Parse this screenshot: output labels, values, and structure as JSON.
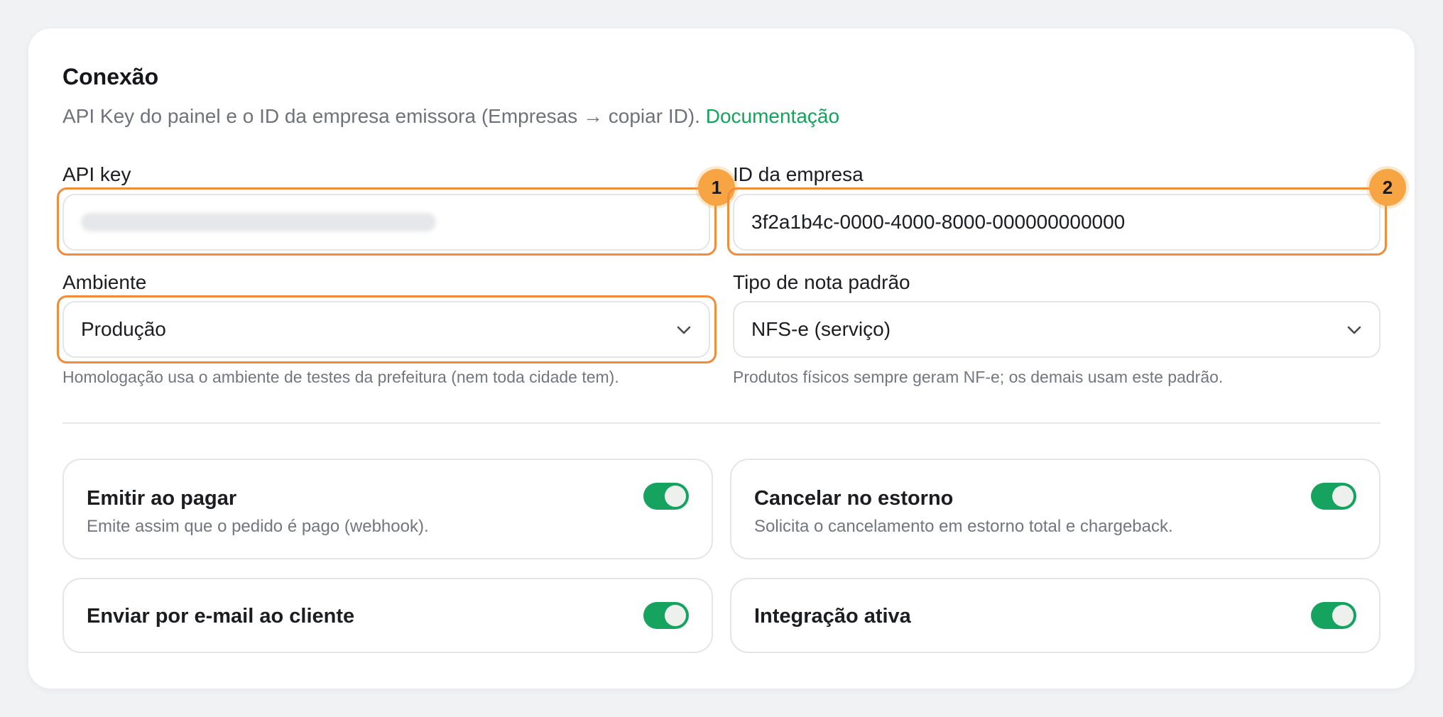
{
  "section": {
    "title": "Conexão",
    "subtitle": "API Key do painel e o ID da empresa emissora (Empresas → copiar ID).",
    "doc_link": "Documentação"
  },
  "fields": {
    "api_key": {
      "label": "API key",
      "value": ""
    },
    "company_id": {
      "label": "ID da empresa",
      "value": "3f2a1b4c-0000-4000-8000-000000000000"
    },
    "environment": {
      "label": "Ambiente",
      "value": "Produção",
      "hint": "Homologação usa o ambiente de testes da prefeitura (nem toda cidade tem)."
    },
    "default_note_type": {
      "label": "Tipo de nota padrão",
      "value": "NFS-e (serviço)",
      "hint": "Produtos físicos sempre geram NF-e; os demais usam este padrão."
    }
  },
  "badges": [
    "1",
    "2"
  ],
  "toggles": [
    {
      "title": "Emitir ao pagar",
      "description": "Emite assim que o pedido é pago (webhook).",
      "on": true
    },
    {
      "title": "Cancelar no estorno",
      "description": "Solicita o cancelamento em estorno total e chargeback.",
      "on": true
    },
    {
      "title": "Enviar por e-mail ao cliente",
      "description": "",
      "on": true
    },
    {
      "title": "Integração ativa",
      "description": "",
      "on": true
    }
  ],
  "colors": {
    "accent": "#12a45b",
    "highlight": "#f28c38",
    "badge": "#f7a542",
    "switch_on": "#16a35f"
  }
}
